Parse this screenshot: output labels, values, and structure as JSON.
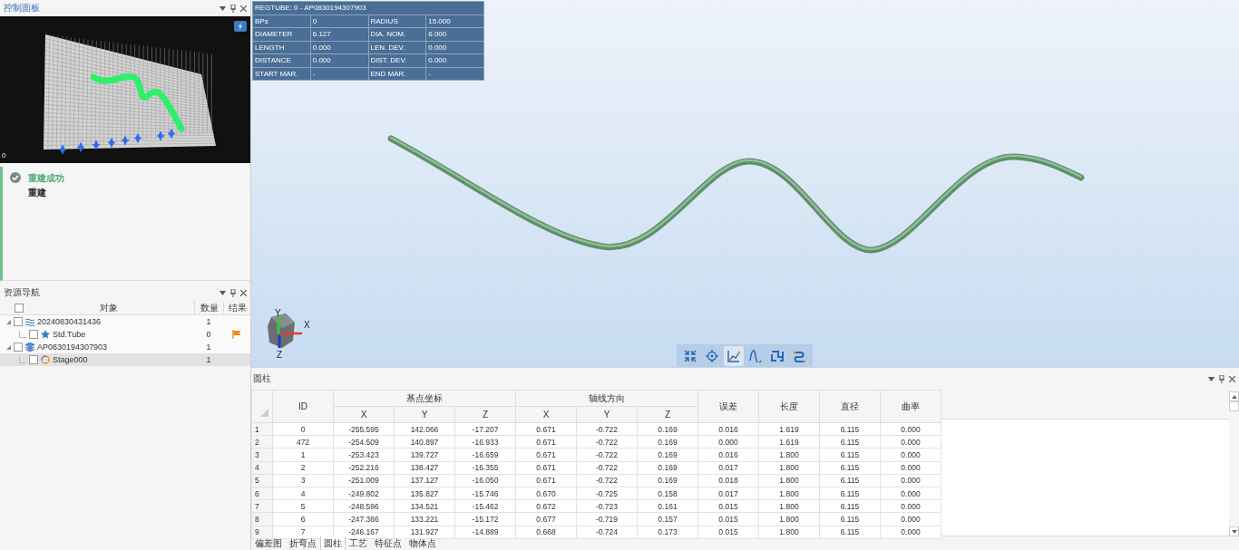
{
  "control_panel": {
    "title": "控制面板",
    "preview_label": "0",
    "message": {
      "title": "重建成功",
      "detail": "重建"
    }
  },
  "navigator": {
    "title": "资源导航",
    "select_all": {
      "checked": false
    },
    "columns": [
      "对象",
      "数量",
      "结果"
    ],
    "items": [
      {
        "kind": "batch",
        "label": "20240830431436",
        "count": "1",
        "checked": false,
        "expanded": true,
        "flagged": false,
        "selected": false,
        "children": [
          {
            "kind": "standard",
            "label": "Std.Tube",
            "count": "0",
            "checked": false,
            "flagged": true,
            "selected": false
          }
        ]
      },
      {
        "kind": "part",
        "label": "AP0830194307903",
        "count": "1",
        "checked": false,
        "expanded": true,
        "flagged": false,
        "selected": false,
        "children": [
          {
            "kind": "stage",
            "label": "Stage000",
            "count": "1",
            "checked": false,
            "flagged": false,
            "selected": true
          }
        ]
      }
    ]
  },
  "info_table": {
    "title": "REGTUBE: 0 - AP0830194307903",
    "rows": [
      [
        "BPs",
        "0",
        "RADIUS",
        "15.000"
      ],
      [
        "DIAMETER",
        "6.127",
        "DIA. NOM.",
        "6.000"
      ],
      [
        "LENGTH",
        "0.000",
        "LEN. DEV.",
        "0.000"
      ],
      [
        "DISTANCE",
        "0.000",
        "DIST. DEV.",
        "0.000"
      ],
      [
        "START MAR.",
        "-",
        "END MAR.",
        "-"
      ]
    ]
  },
  "axes": [
    "Y",
    "X",
    "Z"
  ],
  "toolbar": [
    {
      "kind": "fit",
      "selected": false
    },
    {
      "kind": "center",
      "selected": false
    },
    {
      "kind": "curve",
      "selected": true
    },
    {
      "kind": "wave",
      "selected": false
    },
    {
      "kind": "step",
      "selected": false
    },
    {
      "kind": "scurve",
      "selected": false
    }
  ],
  "bottom_panel": {
    "title": "圆柱",
    "header": {
      "id": "ID",
      "groups": [
        {
          "label": "基点坐标",
          "columns": [
            "X",
            "Y",
            "Z"
          ]
        },
        {
          "label": "轴线方向",
          "columns": [
            "X",
            "Y",
            "Z"
          ]
        }
      ],
      "trailing": [
        "误差",
        "长度",
        "直径",
        "曲率"
      ]
    },
    "rows": [
      {
        "num": "1",
        "cells": [
          "0",
          "-255.595",
          "142.066",
          "-17.207",
          "0.671",
          "-0.722",
          "0.169",
          "0.016",
          "1.619",
          "6.115",
          "0.000"
        ]
      },
      {
        "num": "2",
        "cells": [
          "472",
          "-254.509",
          "140.897",
          "-16.933",
          "0.671",
          "-0.722",
          "0.169",
          "0.000",
          "1.619",
          "6.115",
          "0.000"
        ]
      },
      {
        "num": "3",
        "cells": [
          "1",
          "-253.423",
          "139.727",
          "-16.659",
          "0.671",
          "-0.722",
          "0.169",
          "0.016",
          "1.800",
          "6.115",
          "0.000"
        ]
      },
      {
        "num": "4",
        "cells": [
          "2",
          "-252.216",
          "138.427",
          "-16.355",
          "0.671",
          "-0.722",
          "0.169",
          "0.017",
          "1.800",
          "6.115",
          "0.000"
        ]
      },
      {
        "num": "5",
        "cells": [
          "3",
          "-251.009",
          "137.127",
          "-16.050",
          "0.671",
          "-0.722",
          "0.169",
          "0.018",
          "1.800",
          "6.115",
          "0.000"
        ]
      },
      {
        "num": "6",
        "cells": [
          "4",
          "-249.802",
          "135.827",
          "-15.746",
          "0.670",
          "-0.725",
          "0.158",
          "0.017",
          "1.800",
          "6.115",
          "0.000"
        ]
      },
      {
        "num": "7",
        "cells": [
          "5",
          "-248.596",
          "134.521",
          "-15.462",
          "0.672",
          "-0.723",
          "0.161",
          "0.015",
          "1.800",
          "6.115",
          "0.000"
        ]
      },
      {
        "num": "8",
        "cells": [
          "6",
          "-247.386",
          "133.221",
          "-15.172",
          "0.677",
          "-0.719",
          "0.157",
          "0.015",
          "1.800",
          "6.115",
          "0.000"
        ]
      },
      {
        "num": "9",
        "cells": [
          "7",
          "-246.167",
          "131.927",
          "-14.889",
          "0.668",
          "-0.724",
          "0.173",
          "0.015",
          "1.800",
          "6.115",
          "0.000"
        ]
      }
    ],
    "tabs": [
      {
        "label": "偏差图",
        "selected": false
      },
      {
        "label": "折弯点",
        "selected": false
      },
      {
        "label": "圆柱",
        "selected": true
      },
      {
        "label": "工艺",
        "selected": false
      },
      {
        "label": "特征点",
        "selected": false
      },
      {
        "label": "物体点",
        "selected": false
      }
    ]
  }
}
